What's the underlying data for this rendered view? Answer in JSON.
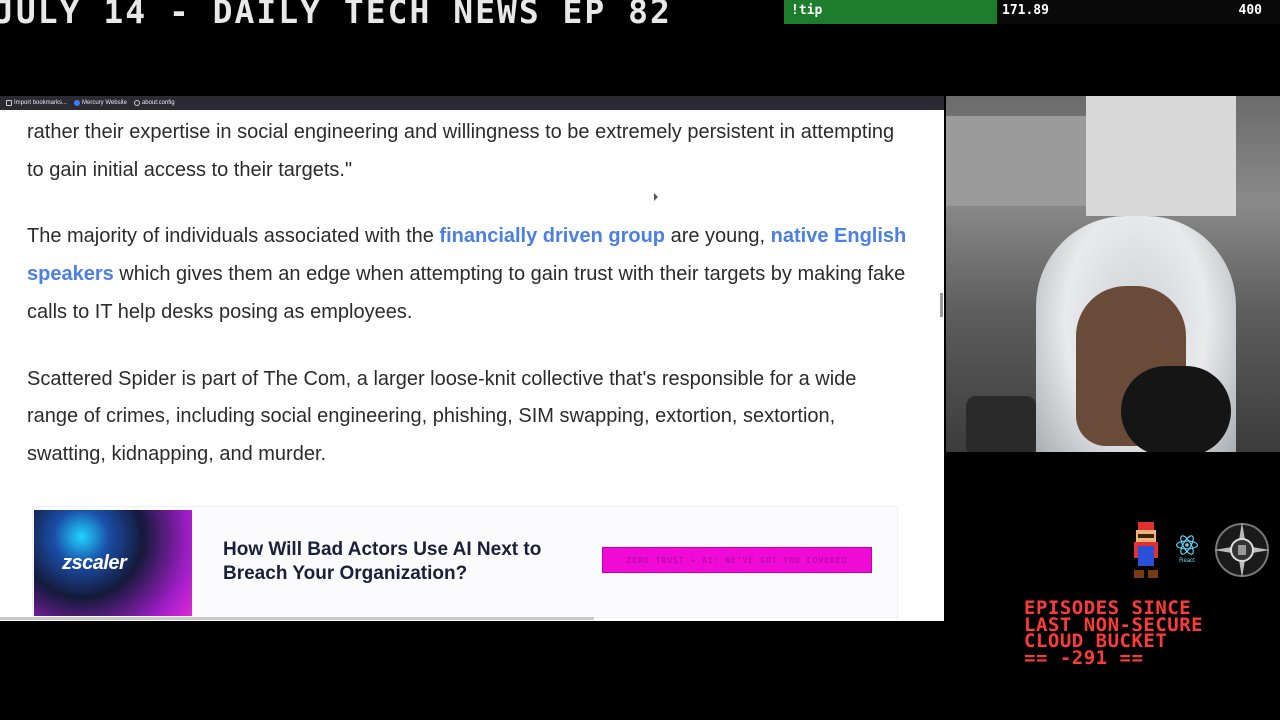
{
  "stream": {
    "title": "JULY 14 - DAILY TECH NEWS EP 82",
    "tip_label": "!tip",
    "tip_current": "171.89",
    "tip_goal": "400",
    "tip_progress": 0.43,
    "tip_color": "#1e7d2c"
  },
  "browser": {
    "bookmarks": [
      {
        "label": "Import bookmarks...",
        "icon": "import-icon"
      },
      {
        "label": "Mercury Website",
        "icon": "mercury-icon"
      },
      {
        "label": "about:config",
        "icon": "gear-icon"
      }
    ],
    "article": {
      "p1": "rather their expertise in social engineering and willingness to be extremely persistent in attempting to gain initial access to their targets.\"",
      "p2_before": "The majority of individuals associated with the ",
      "p2_link1": "financially driven group",
      "p2_mid": " are young, ",
      "p2_link2": "native English speakers",
      "p2_after": " which gives them an edge when attempting to gain trust with their targets by making fake calls to IT help desks posing as employees.",
      "p3": "Scattered Spider is part of The Com, a larger loose-knit collective that's responsible for a wide range of crimes, including social engineering, phishing, SIM swapping, extortion, sextortion, swatting, kidnapping, and murder."
    },
    "ad": {
      "brand": "zscaler",
      "headline": "How Will Bad Actors Use AI Next to Breach Your Organization?",
      "cta": "ZERO TRUST + AI: WE'VE GOT YOU COVERED"
    },
    "link_color": "#4a7fe6"
  },
  "overlay": {
    "counter_text": "EPISODES SINCE\nLAST NON-SECURE\nCLOUD BUCKET\n== -291 ==",
    "counter_color": "#ff3a3a",
    "react_label": "React"
  }
}
